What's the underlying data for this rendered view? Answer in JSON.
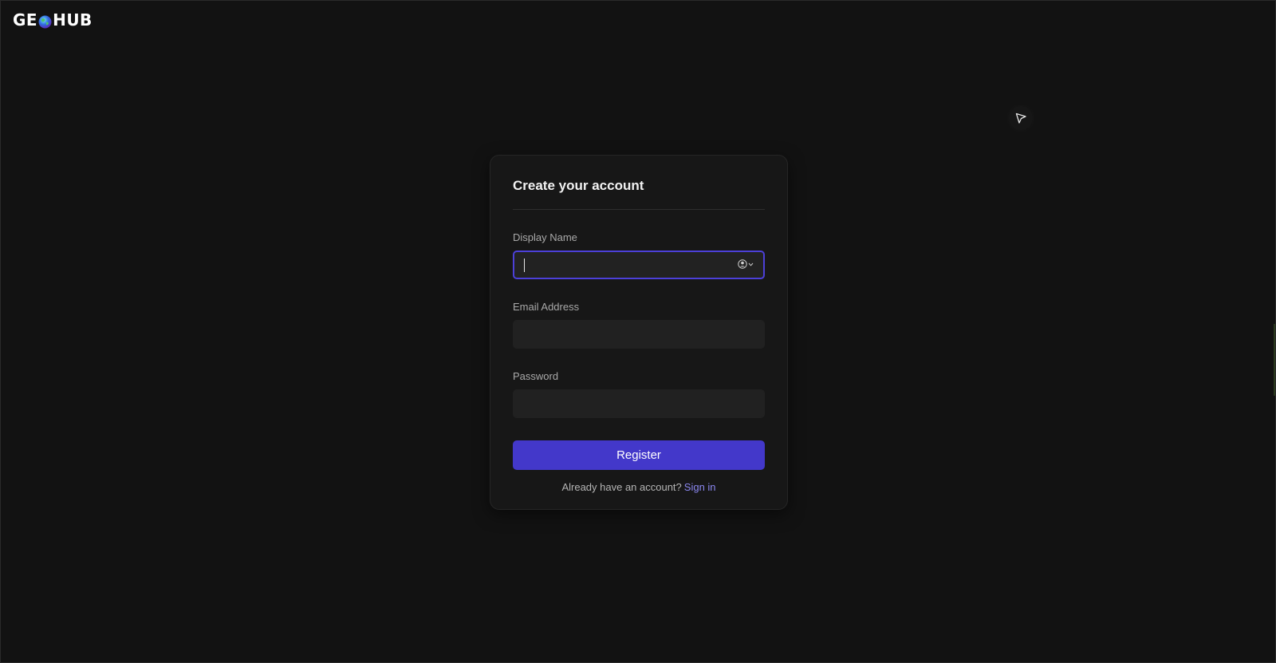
{
  "brand": {
    "logo_left": "GE",
    "logo_right": "HUB",
    "globe_icon": "globe-icon"
  },
  "floating": {
    "icon": "cursor-pointer-icon"
  },
  "form": {
    "title": "Create your account",
    "fields": [
      {
        "label": "Display Name",
        "value": "",
        "placeholder": "",
        "focused": true,
        "icon": "contact-autofill-icon"
      },
      {
        "label": "Email Address",
        "value": "",
        "placeholder": ""
      },
      {
        "label": "Password",
        "value": "",
        "placeholder": ""
      }
    ],
    "submit_label": "Register",
    "footer_text": "Already have an account?",
    "footer_link": "Sign in"
  },
  "colors": {
    "background": "#121212",
    "card": "#171717",
    "input": "#212121",
    "accent": "#4338ca",
    "focus_ring": "#4c40d8",
    "link": "#8b87f0"
  }
}
